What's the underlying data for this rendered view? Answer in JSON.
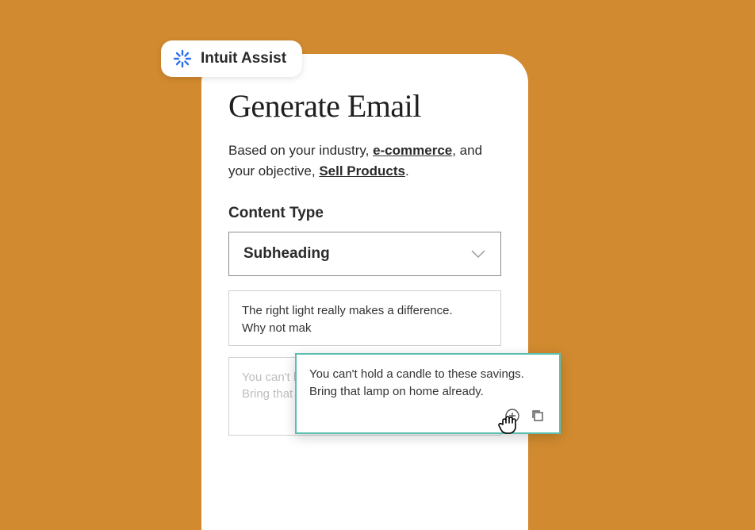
{
  "assist": {
    "label": "Intuit Assist"
  },
  "page": {
    "title": "Generate Email",
    "desc_prefix": "Based on your industry, ",
    "desc_industry": "e-commerce",
    "desc_mid": ", and your objective, ",
    "desc_objective": "Sell Products",
    "desc_suffix": "."
  },
  "content_type": {
    "label": "Content Type",
    "value": "Subheading"
  },
  "suggestions": [
    {
      "line1": "The right light really makes a difference.",
      "line2": "Why not mak"
    },
    {
      "line1": "You can't ho",
      "line2": "Bring that lamp on home already."
    }
  ],
  "tooltip": {
    "line1": "You can't hold a candle to these savings.",
    "line2": "Bring that lamp on home already."
  }
}
